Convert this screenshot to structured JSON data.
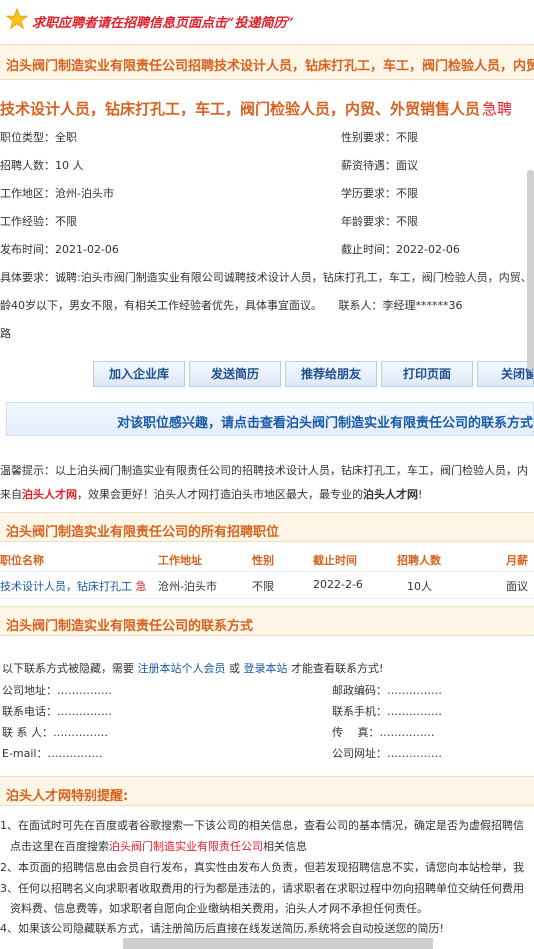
{
  "banner": {
    "text": "求职应聘者请在招聘信息页面点击“投递简历”",
    "icon": "star-icon"
  },
  "header": {
    "title": "泊头阀门制造实业有限责任公司招聘技术设计人员，钻床打孔工，车工，阀门检验人员，内贸"
  },
  "job": {
    "title": "技术设计人员，钻床打孔工，车工，阀门检验人员，内贸、外贸销售人员",
    "urgent": "急聘",
    "rows": [
      {
        "left": "职位类型：全职",
        "right": "性别要求：不限"
      },
      {
        "left": "招聘人数：10 人",
        "right": "薪资待遇：面议"
      },
      {
        "left": "工作地区：沧州-泊头市",
        "right": "学历要求：不限"
      },
      {
        "left": "工作经验：不限",
        "right": "年龄要求：不限"
      },
      {
        "left": "发布时间：2021-02-06",
        "right": "截止时间：2022-02-06"
      }
    ],
    "requirement_line1": "具体要求：诚聘:泊头市阀门制造实业有限公司诚聘技术设计人员，钻床打孔工，车工，阀门检验人员，内贸、",
    "requirement_line2": "龄40岁以下，男女不限，有相关工作经验者优先，具体事宜面议。　　联系人：李经理******36",
    "requirement_line3": "路"
  },
  "actions": {
    "add_company": "加入企业库",
    "send_resume": "发送简历",
    "recommend": "推荐给朋友",
    "print": "打印页面",
    "close": "关闭窗"
  },
  "contact_bar": {
    "text": "对该职位感兴趣，请点击查看泊头阀门制造实业有限责任公司的联系方式"
  },
  "tips": {
    "line1": "温馨提示：以上泊头阀门制造实业有限责任公司的招聘技术设计人员，钻床打孔工，车工，阀门检验人员，内",
    "line2_pre": "来自",
    "line2_site1": "泊头人才网",
    "line2_mid": "，效果会更好！泊头人才网打造泊头市地区最大，最专业的",
    "line2_site2": "泊头人才网",
    "line2_post": "!"
  },
  "all_jobs": {
    "title": "泊头阀门制造实业有限责任公司的所有招聘职位",
    "headers": [
      "职位名称",
      "工作地址",
      "性别",
      "截止时间",
      "招聘人数",
      "月薪"
    ],
    "row": {
      "name": "技术设计人员，钻床打孔工",
      "urgent": "急",
      "location": "沧州-泊头市",
      "gender": "不限",
      "deadline": "2022-2-6",
      "count": "10人",
      "salary": "面议"
    }
  },
  "contact": {
    "title": "泊头阀门制造实业有限责任公司的联系方式",
    "hint_pre": "以下联系方式被隐藏，需要",
    "hint_link1": "注册本站个人会员",
    "hint_or": "或",
    "hint_link2": "登录本站",
    "hint_post": "才能查看联系方式!",
    "address": "公司地址：……………",
    "zip": "邮政编码：……………",
    "phone": "联系电话：……………",
    "mobile": "联系手机：……………",
    "person": "联 系 人：……………",
    "fax": "传　 真：……………",
    "email": "E-mail：……………",
    "website": "公司网址：……………"
  },
  "notice": {
    "title": "泊头人才网特别提醒:",
    "n1": "1、在面试时可先在百度或者谷歌搜索一下该公司的相关信息，查看公司的基本情况，确定是否为虚假招聘信",
    "n1b_pre": "点击这里在百度搜索",
    "n1b_link": "泊头阀门制造实业有限责任公司",
    "n1b_post": "相关信息",
    "n2": "2、本页面的招聘信息由会员自行发布，真实性由发布人负责，但若发现招聘信息不实，请您向本站检举，我",
    "n3": "3、任何以招聘名义向求职者收取费用的行为都是违法的，请求职者在求职过程中勿向招聘单位交纳任何费用",
    "n3b": "资料费、信息费等，如求职者自愿向企业缴纳相关费用，泊头人才网不承担任何责任。",
    "n4": "4、如果该公司隐藏联系方式，请注册简历后直接在线发送简历,系统将会自动投送您的简历!"
  },
  "colors": {
    "accent_orange": "#d8621f",
    "accent_red": "#e0202a",
    "link_blue": "#1a5aa6"
  }
}
